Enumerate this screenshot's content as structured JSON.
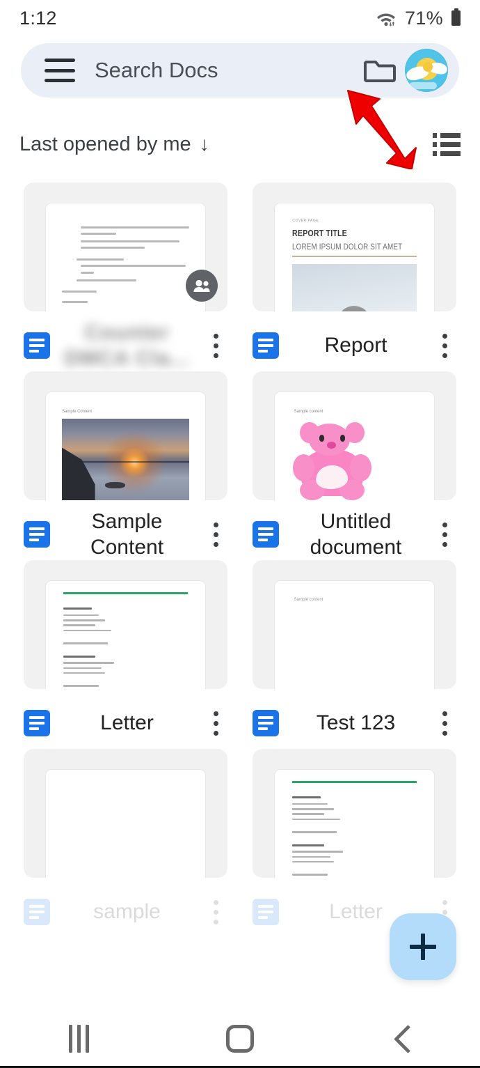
{
  "status_bar": {
    "time": "1:12",
    "battery_percent": "71%",
    "wifi_icon": "wifi-icon",
    "battery_icon": "battery-icon"
  },
  "search": {
    "placeholder": "Search Docs",
    "menu_icon": "hamburger-menu-icon",
    "folder_icon": "folder-icon",
    "avatar_icon": "account-avatar"
  },
  "annotation": {
    "arrow_icon": "red-pointer-arrow",
    "arrow_color": "#ee0000",
    "points_at": "folder-icon"
  },
  "sort": {
    "label": "Last opened by me",
    "direction_arrow": "↓",
    "view_toggle_icon": "list-view-icon"
  },
  "theme": {
    "docs_blue": "#1a73e8",
    "search_bar_bg": "#eaeff7",
    "fab_bg": "#b3dcfa",
    "fab_plus": "#0d2b45",
    "letter_rule_green": "#2aa565"
  },
  "fab": {
    "label": "+",
    "name": "create-new-document-button"
  },
  "nav_bar": {
    "recents": "recents-button",
    "home": "home-button",
    "back": "back-button"
  },
  "documents": [
    {
      "title": "Counter DMCA Cla...",
      "title_redacted": true,
      "thumb_type": "text-doc",
      "shared": true,
      "kebab": "more-options"
    },
    {
      "title": "Report",
      "title_redacted": false,
      "thumb_type": "report",
      "shared": false,
      "kebab": "more-options",
      "thumb_text": {
        "eyebrow": "COVER PAGE",
        "heading": "REPORT TITLE",
        "subheading": "LOREM IPSUM DOLOR SIT AMET"
      }
    },
    {
      "title": "Sample Content",
      "title_redacted": false,
      "thumb_type": "sunset-photo",
      "shared": false,
      "kebab": "more-options",
      "thumb_text": {
        "label": "Sample Content"
      }
    },
    {
      "title": "Untitled document",
      "title_redacted": false,
      "thumb_type": "teddy-photo",
      "shared": false,
      "kebab": "more-options",
      "thumb_text": {
        "label": "Sample content"
      }
    },
    {
      "title": "Letter",
      "title_redacted": false,
      "thumb_type": "letter",
      "shared": false,
      "kebab": "more-options"
    },
    {
      "title": "Test 123",
      "title_redacted": false,
      "thumb_type": "blank-doc",
      "shared": false,
      "kebab": "more-options",
      "thumb_text": {
        "label": "Sample content"
      }
    },
    {
      "title": "sample",
      "title_redacted": false,
      "thumb_type": "blank",
      "shared": false,
      "kebab": "more-options",
      "partially_visible": true
    },
    {
      "title": "Letter",
      "title_redacted": false,
      "thumb_type": "letter",
      "shared": false,
      "kebab": "more-options",
      "partially_visible": true
    }
  ]
}
